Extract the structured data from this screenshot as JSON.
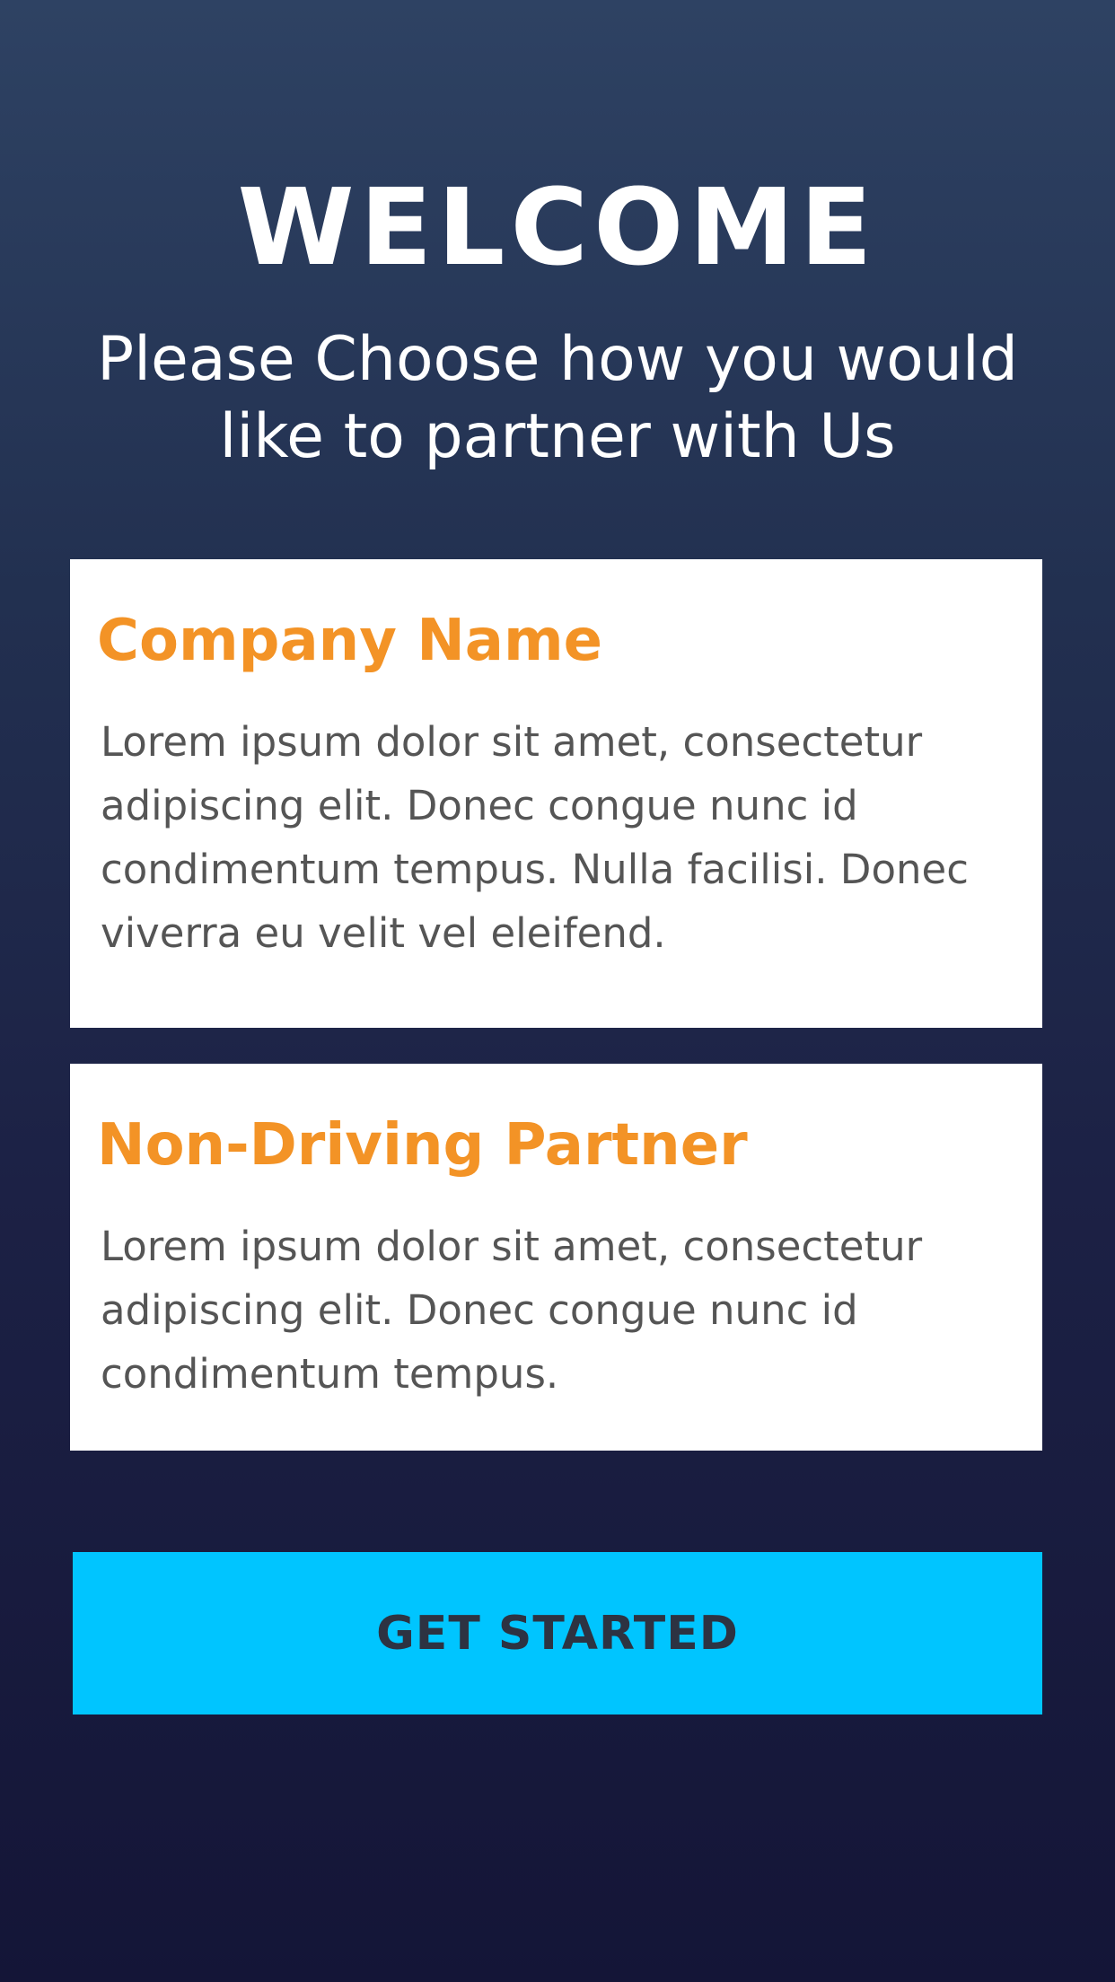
{
  "header": {
    "title": "WELCOME",
    "subtitle": "Please Choose how you would like to partner with Us"
  },
  "options": [
    {
      "title": "Company Name",
      "description": "Lorem ipsum dolor sit amet, consectetur adipiscing elit. Donec congue nunc id condimentum tempus. Nulla facilisi. Donec viverra eu velit vel eleifend."
    },
    {
      "title": "Non-Driving Partner",
      "description": "Lorem ipsum dolor sit amet, consectetur adipiscing elit. Donec congue nunc id condimentum tempus."
    }
  ],
  "cta": {
    "label": "GET STARTED"
  },
  "colors": {
    "accent_title": "#f39326",
    "button_bg": "#00c5ff",
    "bg_top": "#2e4263",
    "bg_bottom": "#141537"
  }
}
